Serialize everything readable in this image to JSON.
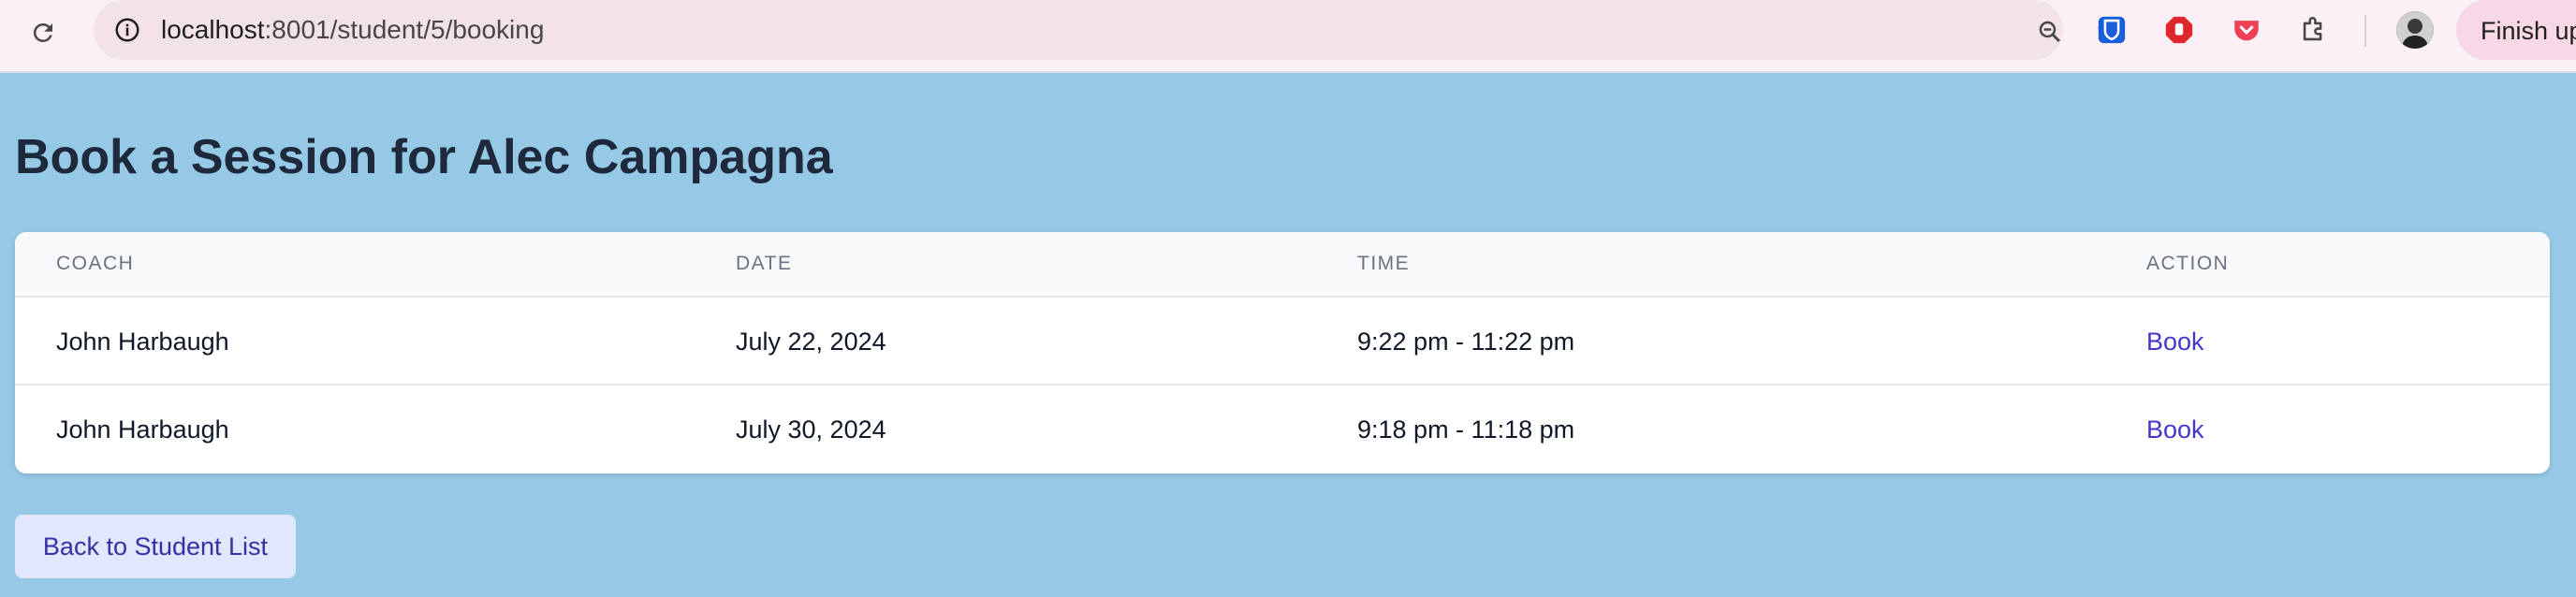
{
  "browser": {
    "url_host": "localhost",
    "url_path": ":8001/student/5/booking",
    "profile_button_label": "Finish up"
  },
  "page": {
    "title": "Book a Session for Alec Campagna"
  },
  "table": {
    "headers": [
      "COACH",
      "DATE",
      "TIME",
      "ACTION"
    ],
    "rows": [
      {
        "coach": "John Harbaugh",
        "date": "July 22, 2024",
        "time": "9:22 pm - 11:22 pm",
        "action": "Book"
      },
      {
        "coach": "John Harbaugh",
        "date": "July 30, 2024",
        "time": "9:18 pm - 11:18 pm",
        "action": "Book"
      }
    ]
  },
  "back_button": {
    "label": "Back to Student List"
  },
  "colors": {
    "page_background": "#96c9e6",
    "link": "#4338ca",
    "title": "#1e293b",
    "button_bg": "#e0e7ff"
  }
}
